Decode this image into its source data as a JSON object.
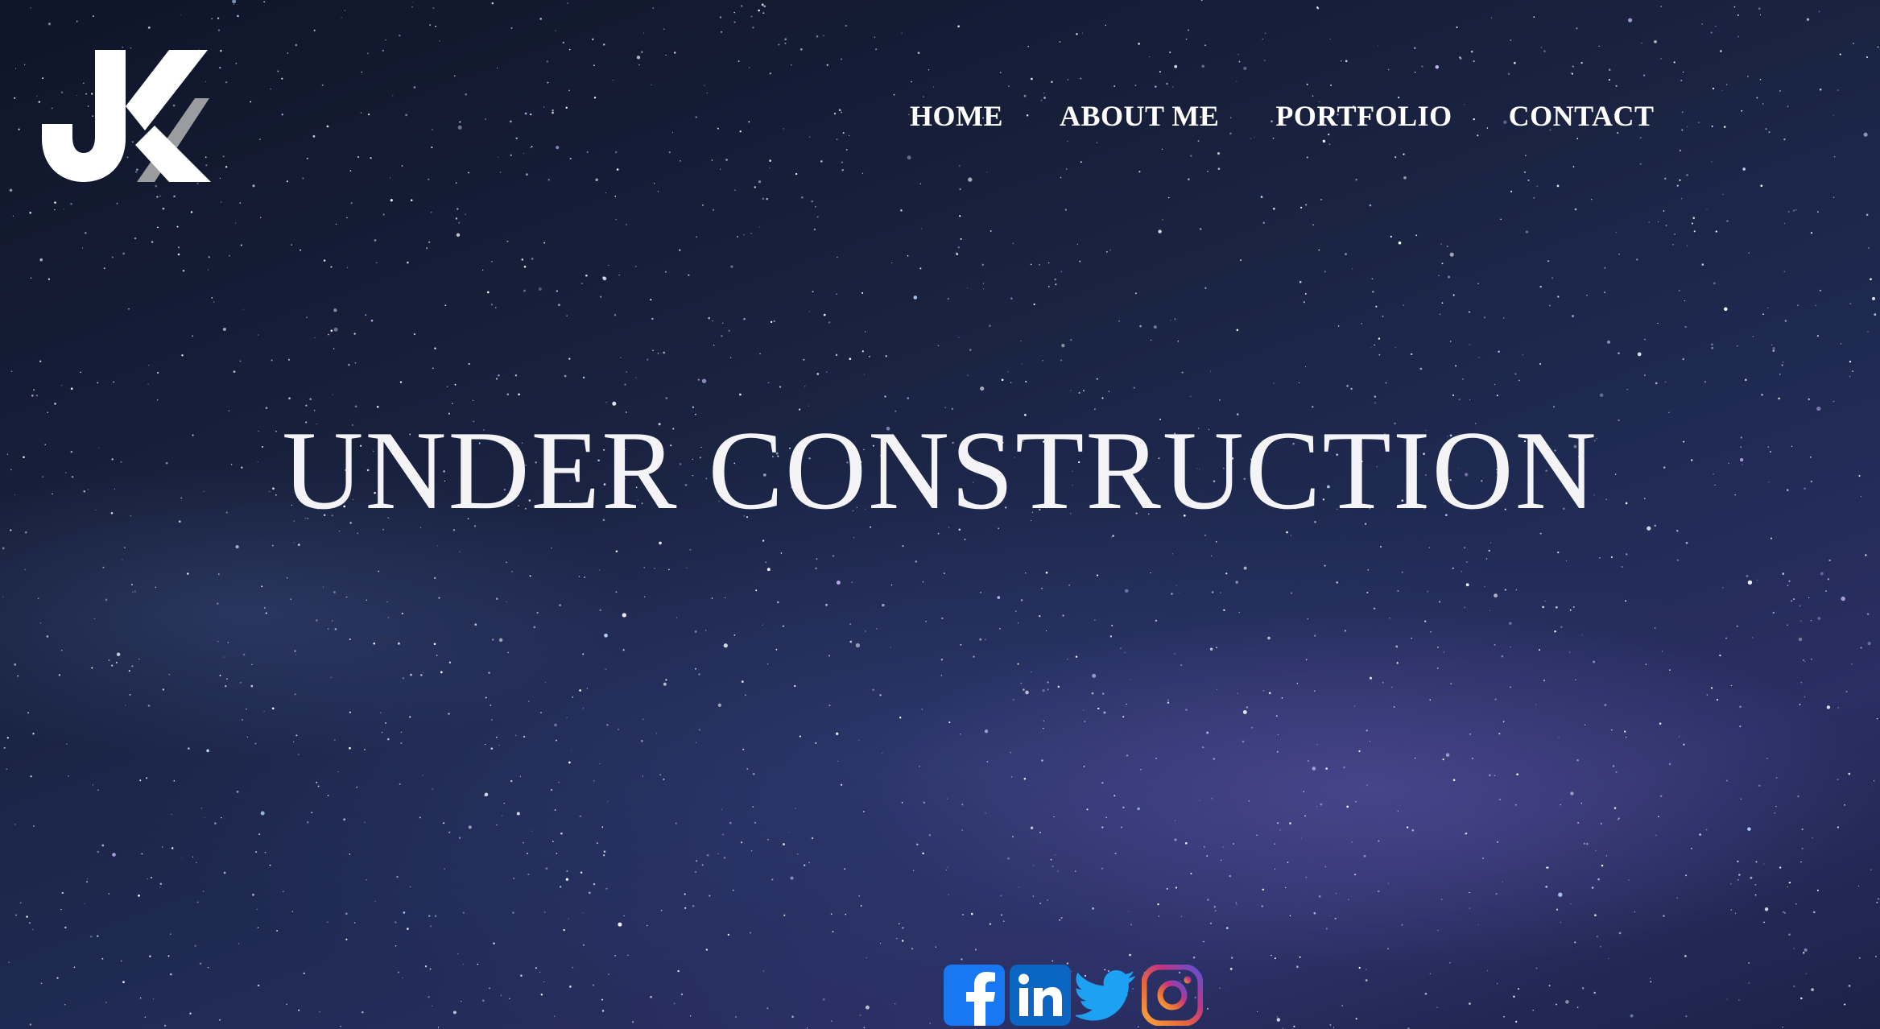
{
  "logo": {
    "icon": "jk-logo-icon",
    "text": "JK"
  },
  "nav": {
    "items": [
      {
        "label": "HOME"
      },
      {
        "label": "ABOUT ME"
      },
      {
        "label": "PORTFOLIO"
      },
      {
        "label": "CONTACT"
      }
    ]
  },
  "hero": {
    "title": "UNDER CONSTRUCTION"
  },
  "social": {
    "items": [
      {
        "name": "facebook",
        "icon": "facebook-icon",
        "color": "#1877f2"
      },
      {
        "name": "linkedin",
        "icon": "linkedin-icon",
        "color": "#0a66c2"
      },
      {
        "name": "twitter",
        "icon": "twitter-icon",
        "color": "#1da1f2"
      },
      {
        "name": "instagram",
        "icon": "instagram-icon",
        "color": "#c13584"
      }
    ]
  },
  "colors": {
    "background": "#141c33",
    "text": "#ffffff"
  }
}
